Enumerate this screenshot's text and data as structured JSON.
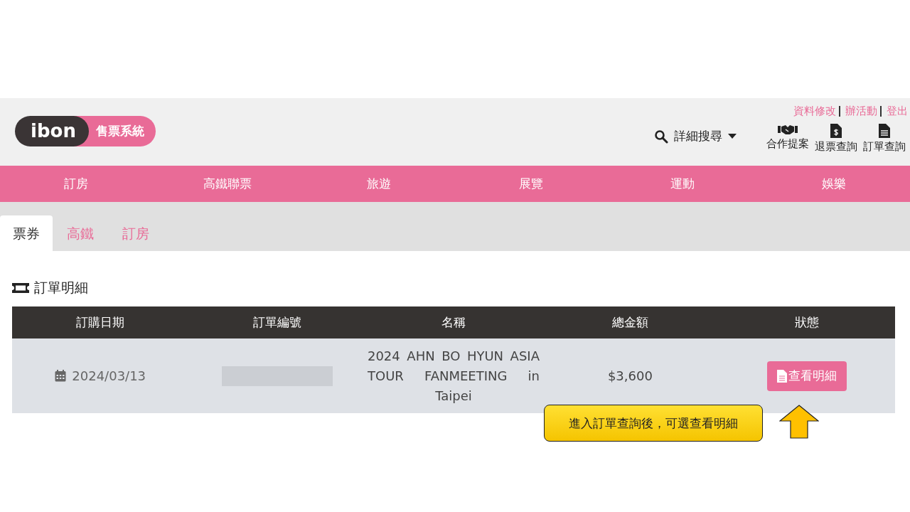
{
  "logo": {
    "brand": "ibon",
    "tagline": "售票系統"
  },
  "top_links": [
    "資料修改",
    "辦活動",
    "登出"
  ],
  "search": {
    "label": "詳細搜尋"
  },
  "shortcuts": [
    {
      "kind": "handshake",
      "label": "合作提案"
    },
    {
      "kind": "refund",
      "label": "退票查詢"
    },
    {
      "kind": "document",
      "label": "訂單查詢"
    }
  ],
  "nav": [
    "訂房",
    "高鐵聯票",
    "旅遊",
    "展覽",
    "運動",
    "娛樂"
  ],
  "tabs": [
    {
      "label": "票券",
      "selected": true
    },
    {
      "label": "高鐵",
      "selected": false
    },
    {
      "label": "訂房",
      "selected": false
    }
  ],
  "section_title": "訂單明細",
  "table": {
    "columns": [
      "訂購日期",
      "訂單編號",
      "名稱",
      "總金額",
      "狀態"
    ],
    "rows": [
      {
        "date": "2024/03/13",
        "name": "2024 AHN BO HYUN ASIA TOUR FANMEETING in Taipei",
        "total": "$3,600",
        "action": "查看明細"
      }
    ]
  },
  "callout": "進入訂單查詢後，可選查看明細"
}
